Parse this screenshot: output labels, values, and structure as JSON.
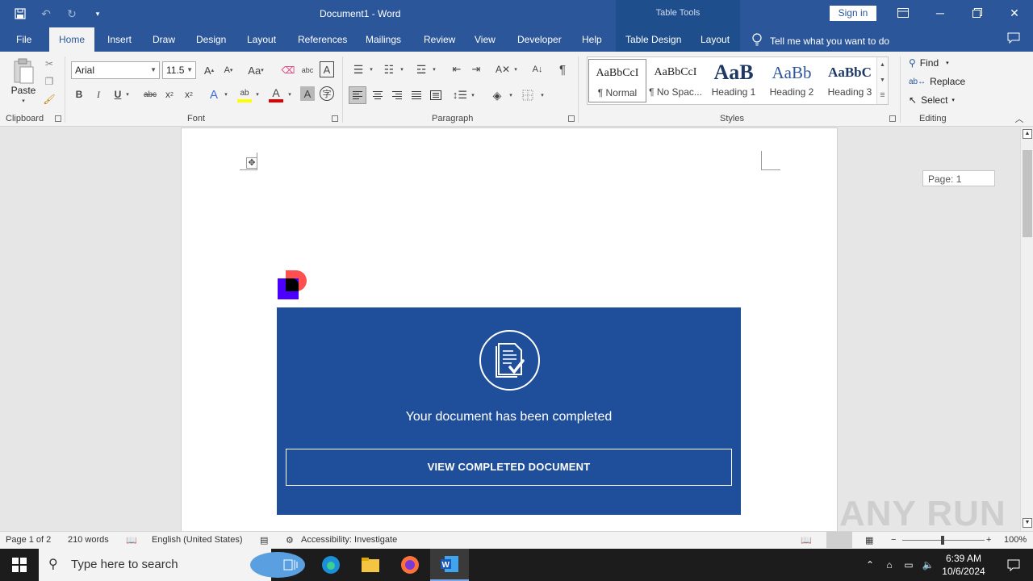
{
  "titlebar": {
    "doc_title": "Document1  -  Word",
    "context_header": "Table Tools",
    "sign_in": "Sign in"
  },
  "tabs": {
    "file": "File",
    "home": "Home",
    "insert": "Insert",
    "draw": "Draw",
    "design": "Design",
    "layout": "Layout",
    "references": "References",
    "mailings": "Mailings",
    "review": "Review",
    "view": "View",
    "developer": "Developer",
    "help": "Help",
    "table_design": "Table Design",
    "table_layout": "Layout",
    "tell_me": "Tell me what you want to do"
  },
  "ribbon": {
    "clipboard": {
      "paste": "Paste",
      "label": "Clipboard"
    },
    "font": {
      "name": "Arial",
      "size": "11.5",
      "label": "Font"
    },
    "paragraph": {
      "label": "Paragraph"
    },
    "styles": {
      "label": "Styles",
      "items": [
        {
          "preview": "AaBbCcI",
          "name": "¶ Normal"
        },
        {
          "preview": "AaBbCcI",
          "name": "¶ No Spac..."
        },
        {
          "preview": "AaB",
          "name": "Heading 1"
        },
        {
          "preview": "AaBb",
          "name": "Heading 2"
        },
        {
          "preview": "AaBbC",
          "name": "Heading 3"
        }
      ]
    },
    "editing": {
      "label": "Editing",
      "find": "Find",
      "replace": "Replace",
      "select": "Select"
    }
  },
  "document": {
    "page_badge": "Page: 1",
    "message": "Your document has been completed",
    "button": "VIEW COMPLETED DOCUMENT",
    "colors": {
      "banner": "#1f4e9b",
      "logo_red": "#ff4f4f",
      "logo_blue": "#4b00ff"
    }
  },
  "statusbar": {
    "page": "Page 1 of 2",
    "words": "210 words",
    "language": "English (United States)",
    "accessibility": "Accessibility: Investigate",
    "zoom": "100%"
  },
  "watermark": "ANY RUN",
  "taskbar": {
    "search_placeholder": "Type here to search",
    "time": "6:39 AM",
    "date": "10/6/2024"
  }
}
